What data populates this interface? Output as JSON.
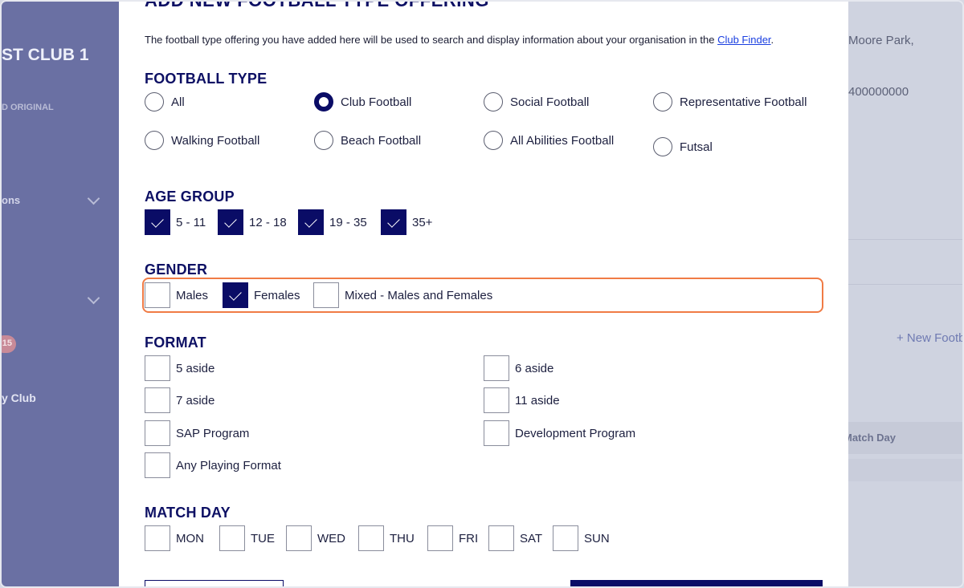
{
  "background": {
    "club_name": "ST CLUB 1",
    "club_sub": "D ORIGINAL",
    "nav_item_1": "ons",
    "badge_count": "15",
    "nav_item_2": "y Club",
    "address": "Moore Park,",
    "phone": "400000000",
    "new_link": "+ New Footb",
    "table_header_match_day": "Match Day"
  },
  "modal": {
    "title": "ADD NEW FOOTBALL TYPE OFFERING",
    "intro_text": "The football type offering you have added here will be used to search and display information about your organisation in the ",
    "intro_link": "Club Finder",
    "intro_end": ".",
    "football_type": {
      "heading": "FOOTBALL TYPE",
      "options": [
        {
          "label": "All",
          "checked": false
        },
        {
          "label": "Club Football",
          "checked": true
        },
        {
          "label": "Social Football",
          "checked": false
        },
        {
          "label": "Representative Football",
          "checked": false
        },
        {
          "label": "Walking Football",
          "checked": false
        },
        {
          "label": "Beach Football",
          "checked": false
        },
        {
          "label": "All Abilities Football",
          "checked": false
        },
        {
          "label": "Futsal",
          "checked": false
        }
      ]
    },
    "age_group": {
      "heading": "AGE GROUP",
      "options": [
        {
          "label": "5 - 11",
          "checked": true
        },
        {
          "label": "12 - 18",
          "checked": true
        },
        {
          "label": "19 - 35",
          "checked": true
        },
        {
          "label": "35+",
          "checked": true
        }
      ]
    },
    "gender": {
      "heading": "GENDER",
      "options": [
        {
          "label": "Males",
          "checked": false
        },
        {
          "label": "Females",
          "checked": true
        },
        {
          "label": "Mixed - Males and Females",
          "checked": false
        }
      ]
    },
    "format": {
      "heading": "FORMAT",
      "options": [
        {
          "label": "5 aside",
          "checked": false
        },
        {
          "label": "6 aside",
          "checked": false
        },
        {
          "label": "7 aside",
          "checked": false
        },
        {
          "label": "11 aside",
          "checked": false
        },
        {
          "label": "SAP Program",
          "checked": false
        },
        {
          "label": "Development Program",
          "checked": false
        },
        {
          "label": "Any Playing Format",
          "checked": false
        }
      ]
    },
    "match_day": {
      "heading": "MATCH DAY",
      "options": [
        {
          "label": "MON",
          "checked": false
        },
        {
          "label": "TUE",
          "checked": false
        },
        {
          "label": "WED",
          "checked": false
        },
        {
          "label": "THU",
          "checked": false
        },
        {
          "label": "FRI",
          "checked": false
        },
        {
          "label": "SAT",
          "checked": false
        },
        {
          "label": "SUN",
          "checked": false
        }
      ]
    }
  },
  "colors": {
    "brand_navy": "#0a0c66",
    "highlight_orange": "#f07b45",
    "link_blue": "#1a3fe0"
  }
}
